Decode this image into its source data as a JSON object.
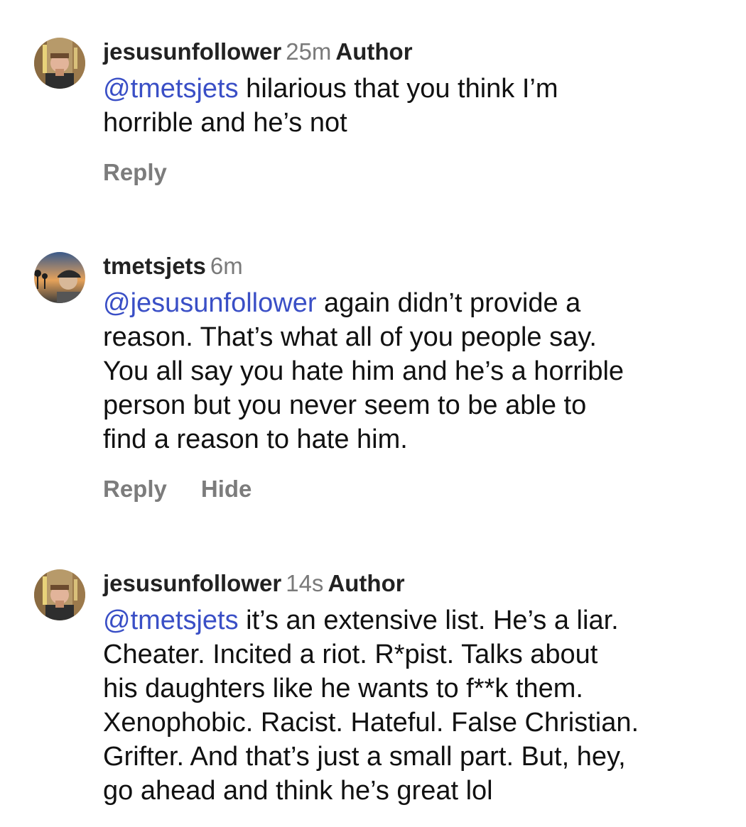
{
  "colors": {
    "mention": "#3a4fc6",
    "username": "#222222",
    "timestamp": "#7a7a7a",
    "action": "#7c7c7c"
  },
  "comments": [
    {
      "avatar": "avatar-icon",
      "username": "jesusunfollower",
      "time": "25m",
      "badge": "Author",
      "mention": "@tmetsjets",
      "text_line1": " hilarious that you think I’m",
      "text_rest": [
        "horrible and he’s not"
      ],
      "actions": [
        "Reply"
      ]
    },
    {
      "avatar": "avatar-icon",
      "username": "tmetsjets",
      "time": "6m",
      "badge": "",
      "mention": "@jesusunfollower",
      "text_line1": " again didn’t provide a",
      "text_rest": [
        "reason. That’s what all of you people say.",
        "You all say you hate him and he’s a horrible",
        "person but you never seem to be able to",
        "find a reason to hate him."
      ],
      "actions": [
        "Reply",
        "Hide"
      ]
    },
    {
      "avatar": "avatar-icon",
      "username": "jesusunfollower",
      "time": "14s",
      "badge": "Author",
      "mention": "@tmetsjets",
      "text_line1": " it’s an extensive list. He’s a liar.",
      "text_rest": [
        "Cheater. Incited a riot. R*pist. Talks about",
        "his daughters like he wants to f**k them.",
        "Xenophobic. Racist. Hateful. False Christian.",
        "Grifter. And that’s just a small part. But, hey,",
        "go ahead and think he’s great lol"
      ],
      "actions": []
    }
  ]
}
